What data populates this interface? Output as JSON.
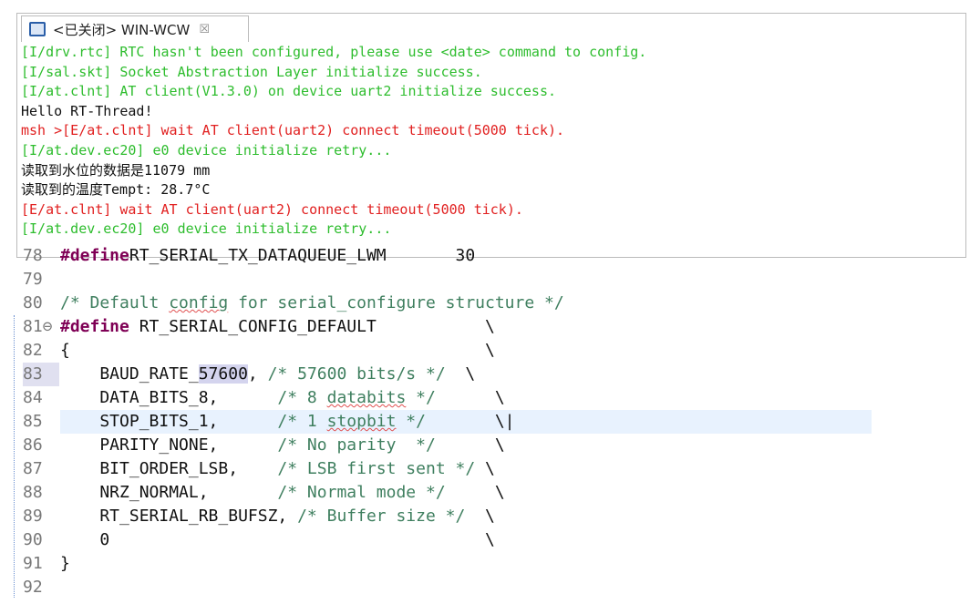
{
  "console": {
    "tab_title": "<已关闭> WIN-WCW",
    "close_glyph": "☒",
    "lines": [
      {
        "text": "[I/drv.rtc] RTC hasn't been configured, please use <date> command to config.",
        "color": "green"
      },
      {
        "text": "[I/sal.skt] Socket Abstraction Layer initialize success.",
        "color": "green"
      },
      {
        "text": "[I/at.clnt] AT client(V1.3.0) on device uart2 initialize success.",
        "color": "green"
      },
      {
        "text": "Hello RT-Thread!",
        "color": "black"
      },
      {
        "text": "msh >[E/at.clnt] wait AT client(uart2) connect timeout(5000 tick).",
        "color": "red"
      },
      {
        "text": "[I/at.dev.ec20] e0 device initialize retry...",
        "color": "green"
      },
      {
        "text": "读取到水位的数据是11079 mm",
        "color": "black"
      },
      {
        "text": "读取到的温度Tempt: 28.7°C",
        "color": "black"
      },
      {
        "text": "[E/at.clnt] wait AT client(uart2) connect timeout(5000 tick).",
        "color": "red"
      },
      {
        "text": "[I/at.dev.ec20] e0 device initialize retry...",
        "color": "green"
      }
    ]
  },
  "editor": {
    "lines": [
      {
        "n": "78",
        "parts": [
          [
            "pp",
            "#define"
          ],
          [
            "",
            "RT_SERIAL_TX_DATAQUEUE_LWM       30"
          ]
        ]
      },
      {
        "n": "79",
        "parts": []
      },
      {
        "n": "80",
        "parts": [
          [
            "cm",
            "/* Default "
          ],
          [
            "cm sq",
            "config"
          ],
          [
            "cm",
            " for serial_configure structure */"
          ]
        ]
      },
      {
        "n": "81⊖",
        "parts": [
          [
            "pp",
            "#define"
          ],
          [
            "",
            " RT_SERIAL_CONFIG_DEFAULT           \\"
          ]
        ]
      },
      {
        "n": "82",
        "parts": [
          [
            "",
            "{                                          \\"
          ]
        ]
      },
      {
        "n": "83",
        "parts": [
          [
            "",
            "    BAUD_RATE_"
          ],
          [
            "hl",
            "57600"
          ],
          [
            "",
            ", "
          ],
          [
            "cm",
            "/* 57600 bits/s */"
          ],
          [
            "",
            "  \\"
          ]
        ]
      },
      {
        "n": "84",
        "parts": [
          [
            "",
            "    DATA_BITS_8,      "
          ],
          [
            "cm",
            "/* 8 "
          ],
          [
            "cm sq",
            "databits"
          ],
          [
            "cm",
            " */"
          ],
          [
            "",
            "      \\"
          ]
        ]
      },
      {
        "n": "85",
        "parts": [
          [
            "",
            "    STOP_BITS_1,      "
          ],
          [
            "cm",
            "/* 1 "
          ],
          [
            "cm sq",
            "stopbit"
          ],
          [
            "cm",
            " */"
          ],
          [
            "",
            "       \\|"
          ]
        ]
      },
      {
        "n": "86",
        "parts": [
          [
            "",
            "    PARITY_NONE,      "
          ],
          [
            "cm",
            "/* No parity  */"
          ],
          [
            "",
            "      \\"
          ]
        ]
      },
      {
        "n": "87",
        "parts": [
          [
            "",
            "    BIT_ORDER_LSB,    "
          ],
          [
            "cm",
            "/* LSB first sent */"
          ],
          [
            "",
            " \\"
          ]
        ]
      },
      {
        "n": "88",
        "parts": [
          [
            "",
            "    NRZ_NORMAL,       "
          ],
          [
            "cm",
            "/* Normal mode */"
          ],
          [
            "",
            "     \\"
          ]
        ]
      },
      {
        "n": "89",
        "parts": [
          [
            "",
            "    RT_SERIAL_RB_BUFSZ, "
          ],
          [
            "cm",
            "/* Buffer size */"
          ],
          [
            "",
            "  \\"
          ]
        ]
      },
      {
        "n": "90",
        "parts": [
          [
            "",
            "    0                                      \\"
          ]
        ]
      },
      {
        "n": "91",
        "parts": [
          [
            "",
            "}"
          ]
        ]
      },
      {
        "n": "92",
        "parts": []
      }
    ],
    "current_line": "85"
  }
}
